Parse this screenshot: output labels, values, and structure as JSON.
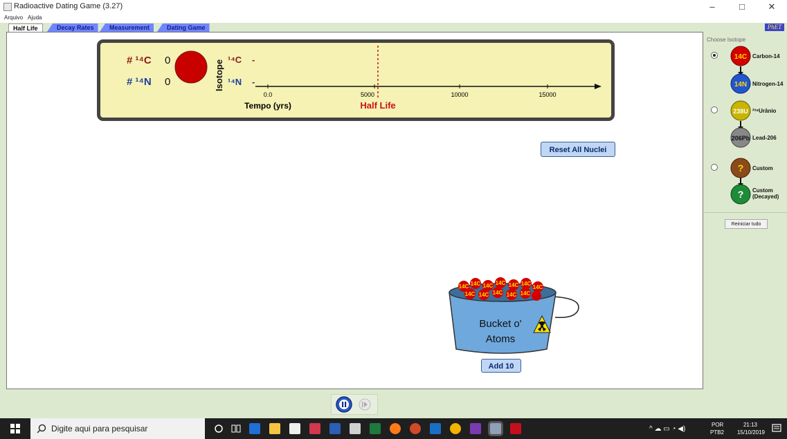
{
  "window": {
    "title": "Radioactive Dating Game (3.27)",
    "minimize": "–",
    "maximize": "□",
    "close": "✕"
  },
  "menu": [
    {
      "label": "Arquivo"
    },
    {
      "label": "Ajuda"
    }
  ],
  "tabs": [
    {
      "label": "Half Life"
    },
    {
      "label": "Decay Rates"
    },
    {
      "label": "Measurement"
    },
    {
      "label": "Dating Game"
    }
  ],
  "logo": "PhET",
  "graph": {
    "c14_count_label": "# ¹⁴C",
    "c14_count": "0",
    "n14_count_label": "# ¹⁴N",
    "n14_count": "0",
    "isotope_axis_label": "Isotope",
    "c14_row_label": "¹⁴C",
    "n14_row_label": "¹⁴N",
    "x_ticks": [
      "0.0",
      "5000",
      "10000",
      "15000"
    ],
    "x_label": "Tempo (yrs)",
    "half_life_label": "Half Life"
  },
  "buttons": {
    "reset_all_nuclei": "Reset All Nuclei",
    "add_10": "Add 10"
  },
  "bucket": {
    "line1": "Bucket o'",
    "line2": "Atoms",
    "atom_symbol": "14C"
  },
  "side_panel": {
    "title": "Choose Isotope",
    "options": [
      {
        "selected": true,
        "parent_symbol": "14C",
        "parent_label": "Carbon-14",
        "daughter_symbol": "14N",
        "daughter_label": "Nitrogen-14"
      },
      {
        "selected": false,
        "parent_symbol": "238U",
        "parent_label": "²³⁸Urânio",
        "daughter_symbol": "206Pb",
        "daughter_label": "Lead-206"
      },
      {
        "selected": false,
        "parent_symbol": "?",
        "parent_label": "Custom",
        "daughter_symbol": "?",
        "daughter_label_1": "Custom",
        "daughter_label_2": "(Decayed)"
      }
    ],
    "reset_all": "Reiniciar tudo"
  },
  "taskbar": {
    "search_placeholder": "Digite aqui para pesquisar",
    "lang_1": "POR",
    "lang_2": "PTB2",
    "time": "21:13",
    "date": "15/10/2019"
  },
  "colors": {
    "c14": "#8b1a1a",
    "n14": "#1d3fa0",
    "half_life": "#cc1111",
    "panel_bg": "#f5f2b4"
  }
}
